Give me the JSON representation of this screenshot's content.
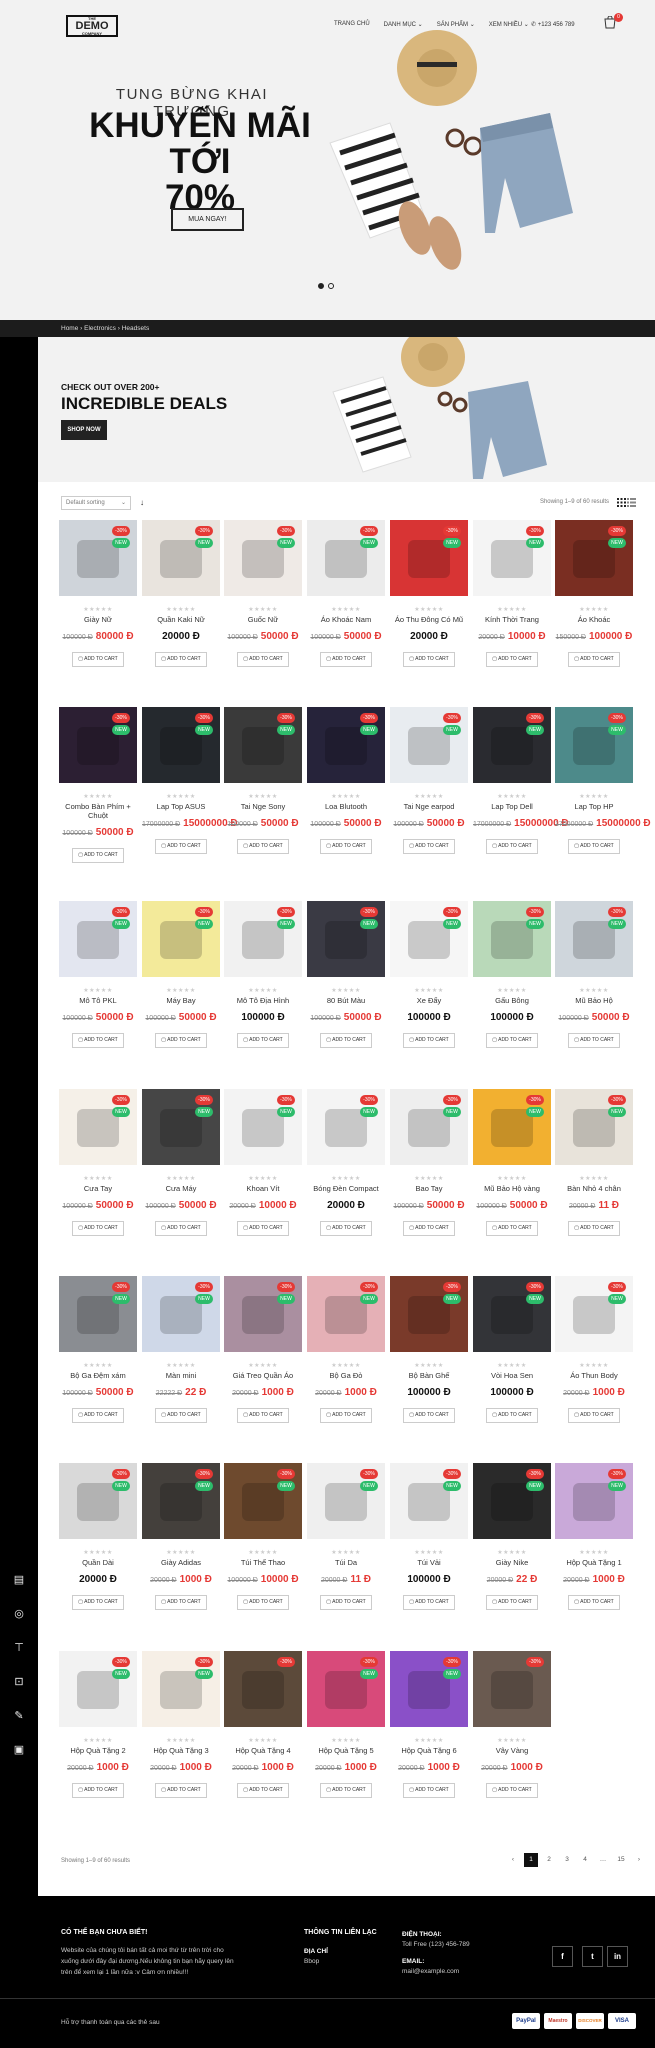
{
  "header": {
    "logo_small_top": "THE",
    "logo_text": "DEMO",
    "logo_small_bottom": "COMPANY",
    "nav": [
      "TRANG CHỦ",
      "DANH MỤC ⌄",
      "SẢN PHẨM ⌄",
      "XEM NHIỀU ⌄"
    ],
    "phone": "+123 456 789",
    "cart_count": "0"
  },
  "hero": {
    "subtitle": "TUNG BỪNG KHAI TRƯƠNG",
    "title_line1": "KHUYẾN MÃI TỚI",
    "title_line2": "70%",
    "button": "MUA NGAY!"
  },
  "breadcrumb": [
    "Home",
    "Electronics",
    "Headsets"
  ],
  "banner": {
    "line1": "CHECK OUT OVER 200+",
    "line2": "INCREDIBLE DEALS",
    "button": "SHOP NOW"
  },
  "toolbar": {
    "sort": "Default sorting",
    "showing": "Showing 1–9 of 60 results"
  },
  "ui": {
    "add_to_cart": "ADD TO CART",
    "sale": "-30%",
    "new": "NEW",
    "stars": "★★★★★"
  },
  "products": [
    {
      "name": "Giày Nữ",
      "old": "100000 Đ",
      "price": "80000 Đ",
      "new": true,
      "color": "#cfd4da"
    },
    {
      "name": "Quần Kaki Nữ",
      "old": "",
      "price": "20000 Đ",
      "new": true,
      "color": "#e9e4de"
    },
    {
      "name": "Guốc Nữ",
      "old": "100000 Đ",
      "price": "50000 Đ",
      "new": true,
      "color": "#efeae6"
    },
    {
      "name": "Áo Khoác Nam",
      "old": "100000 Đ",
      "price": "50000 Đ",
      "new": true,
      "color": "#ececec"
    },
    {
      "name": "Áo Thu Đông Có Mũ",
      "old": "",
      "price": "20000 Đ",
      "new": true,
      "color": "#d83434"
    },
    {
      "name": "Kính Thời Trang",
      "old": "20000 Đ",
      "price": "10000 Đ",
      "new": true,
      "color": "#f4f4f4"
    },
    {
      "name": "Áo Khoác",
      "old": "150000 Đ",
      "price": "100000 Đ",
      "new": true,
      "color": "#7a2e22"
    },
    {
      "name": "Combo Bàn Phím + Chuột",
      "old": "100000 Đ",
      "price": "50000 Đ",
      "new": true,
      "color": "#2c1f33"
    },
    {
      "name": "Lap Top ASUS",
      "old": "17000000 Đ",
      "price": "15000000 Đ",
      "new": true,
      "color": "#25292e"
    },
    {
      "name": "Tai Nge Sony",
      "old": "100000 Đ",
      "price": "50000 Đ",
      "new": true,
      "color": "#3a3a3a"
    },
    {
      "name": "Loa Blutooth",
      "old": "100000 Đ",
      "price": "50000 Đ",
      "new": true,
      "color": "#26233a"
    },
    {
      "name": "Tai Nge earpod",
      "old": "100000 Đ",
      "price": "50000 Đ",
      "new": true,
      "color": "#e8ecf0"
    },
    {
      "name": "Lap Top Dell",
      "old": "17000000 Đ",
      "price": "15000000 Đ",
      "new": true,
      "color": "#2a2b30"
    },
    {
      "name": "Lap Top HP",
      "old": "17000000 Đ",
      "price": "15000000 Đ",
      "new": true,
      "color": "#4d8a8a"
    },
    {
      "name": "Mô Tô PKL",
      "old": "100000 Đ",
      "price": "50000 Đ",
      "new": true,
      "color": "#e3e6f0"
    },
    {
      "name": "Máy Bay",
      "old": "100000 Đ",
      "price": "50000 Đ",
      "new": true,
      "color": "#f3ea9a"
    },
    {
      "name": "Mô Tô Địa Hình",
      "old": "",
      "price": "100000 Đ",
      "new": true,
      "color": "#f1f1f1"
    },
    {
      "name": "80 Bút Màu",
      "old": "100000 Đ",
      "price": "50000 Đ",
      "new": true,
      "color": "#3a3a44"
    },
    {
      "name": "Xe Đẩy",
      "old": "",
      "price": "100000 Đ",
      "new": true,
      "color": "#f6f6f6"
    },
    {
      "name": "Gấu Bông",
      "old": "",
      "price": "100000 Đ",
      "new": true,
      "color": "#b9d9b9"
    },
    {
      "name": "Mũ Bảo Hộ",
      "old": "100000 Đ",
      "price": "50000 Đ",
      "new": true,
      "color": "#cfd6dc"
    },
    {
      "name": "Cưa Tay",
      "old": "100000 Đ",
      "price": "50000 Đ",
      "new": true,
      "color": "#f5f0e8"
    },
    {
      "name": "Cưa Máy",
      "old": "100000 Đ",
      "price": "50000 Đ",
      "new": true,
      "color": "#464646"
    },
    {
      "name": "Khoan Vít",
      "old": "20000 Đ",
      "price": "10000 Đ",
      "new": true,
      "color": "#f3f3f3"
    },
    {
      "name": "Bóng Đèn Compact",
      "old": "",
      "price": "20000 Đ",
      "new": true,
      "color": "#f4f4f4"
    },
    {
      "name": "Bao Tay",
      "old": "100000 Đ",
      "price": "50000 Đ",
      "new": true,
      "color": "#eeeeee"
    },
    {
      "name": "Mũ Bảo Hộ vàng",
      "old": "100000 Đ",
      "price": "50000 Đ",
      "new": true,
      "color": "#f2b030"
    },
    {
      "name": "Bàn Nhỏ 4 chân",
      "old": "20000 Đ",
      "price": "11 Đ",
      "new": true,
      "color": "#e8e3da"
    },
    {
      "name": "Bộ Ga Đệm xám",
      "old": "100000 Đ",
      "price": "50000 Đ",
      "new": true,
      "color": "#8a8d92"
    },
    {
      "name": "Màn mini",
      "old": "22222 Đ",
      "price": "22 Đ",
      "new": true,
      "color": "#cfd8e8"
    },
    {
      "name": "Giá Treo Quần Áo",
      "old": "20000 Đ",
      "price": "1000 Đ",
      "new": true,
      "color": "#aa8fa0"
    },
    {
      "name": "Bộ Ga Đỏ",
      "old": "20000 Đ",
      "price": "1000 Đ",
      "new": true,
      "color": "#e5b0b6"
    },
    {
      "name": "Bộ Bàn Ghế",
      "old": "",
      "price": "100000 Đ",
      "new": true,
      "color": "#7a3a2a"
    },
    {
      "name": "Vòi Hoa Sen",
      "old": "",
      "price": "100000 Đ",
      "new": true,
      "color": "#333438"
    },
    {
      "name": "Áo Thun Body",
      "old": "20000 Đ",
      "price": "1000 Đ",
      "new": true,
      "color": "#f4f4f4"
    },
    {
      "name": "Quần Dài",
      "old": "",
      "price": "20000 Đ",
      "new": true,
      "color": "#d9d9d9"
    },
    {
      "name": "Giày Adidas",
      "old": "20000 Đ",
      "price": "1000 Đ",
      "new": true,
      "color": "#44403c"
    },
    {
      "name": "Túi Thể Thao",
      "old": "100000 Đ",
      "price": "10000 Đ",
      "new": true,
      "color": "#6e4a2e"
    },
    {
      "name": "Túi Da",
      "old": "20000 Đ",
      "price": "11 Đ",
      "new": true,
      "color": "#efefef"
    },
    {
      "name": "Túi Vải",
      "old": "",
      "price": "100000 Đ",
      "new": true,
      "color": "#f1f1f1"
    },
    {
      "name": "Giày Nike",
      "old": "20000 Đ",
      "price": "22 Đ",
      "new": true,
      "color": "#2a2a2a"
    },
    {
      "name": "Hộp Quà Tặng 1",
      "old": "20000 Đ",
      "price": "1000 Đ",
      "new": true,
      "color": "#c9a9d9"
    },
    {
      "name": "Hộp Quà Tặng 2",
      "old": "20000 Đ",
      "price": "1000 Đ",
      "new": true,
      "color": "#f2f2f2"
    },
    {
      "name": "Hộp Quà Tặng 3",
      "old": "20000 Đ",
      "price": "1000 Đ",
      "new": true,
      "color": "#f6efe6"
    },
    {
      "name": "Hộp Quà Tặng 4",
      "old": "20000 Đ",
      "price": "1000 Đ",
      "new": false,
      "color": "#5c4a3a"
    },
    {
      "name": "Hộp Quà Tặng 5",
      "old": "20000 Đ",
      "price": "1000 Đ",
      "new": true,
      "color": "#d84a7a"
    },
    {
      "name": "Hộp Quà Tặng 6",
      "old": "20000 Đ",
      "price": "1000 Đ",
      "new": true,
      "color": "#8a50c8"
    },
    {
      "name": "Vây Vàng",
      "old": "20000 Đ",
      "price": "1000 Đ",
      "new": false,
      "color": "#6a5a50"
    }
  ],
  "pagination": {
    "info": "Showing 1–9 of 60 results",
    "prev": "‹",
    "pages": [
      "1",
      "2",
      "3",
      "4",
      "…",
      "15"
    ],
    "next": "›"
  },
  "footer": {
    "about_title": "CÓ THỂ BẠN CHƯA BIẾT!",
    "about_text": "Website của chúng tôi bán tất cả moi thứ từ trên trời cho xuống dưới đây đại dương.Nếu không tin bạn hãy query lên trên để xem lại 1 lần nữa :v Cảm ơn nhiều!!!",
    "contact_title": "THÔNG TIN LIÊN LẠC",
    "address_label": "ĐỊA CHỈ",
    "address": "Bbop",
    "phone_label": "ĐIỆN THOẠI:",
    "phone": "Toll Free (123) 456-789",
    "email_label": "EMAIL:",
    "email": "mail@example.com",
    "social": [
      "f",
      "t",
      "in"
    ],
    "payment_text": "Hỗ trợ thanh toán qua các thẻ sau",
    "payments": [
      "PayPal",
      "Maestro",
      "DISCOVER",
      "VISA"
    ]
  }
}
